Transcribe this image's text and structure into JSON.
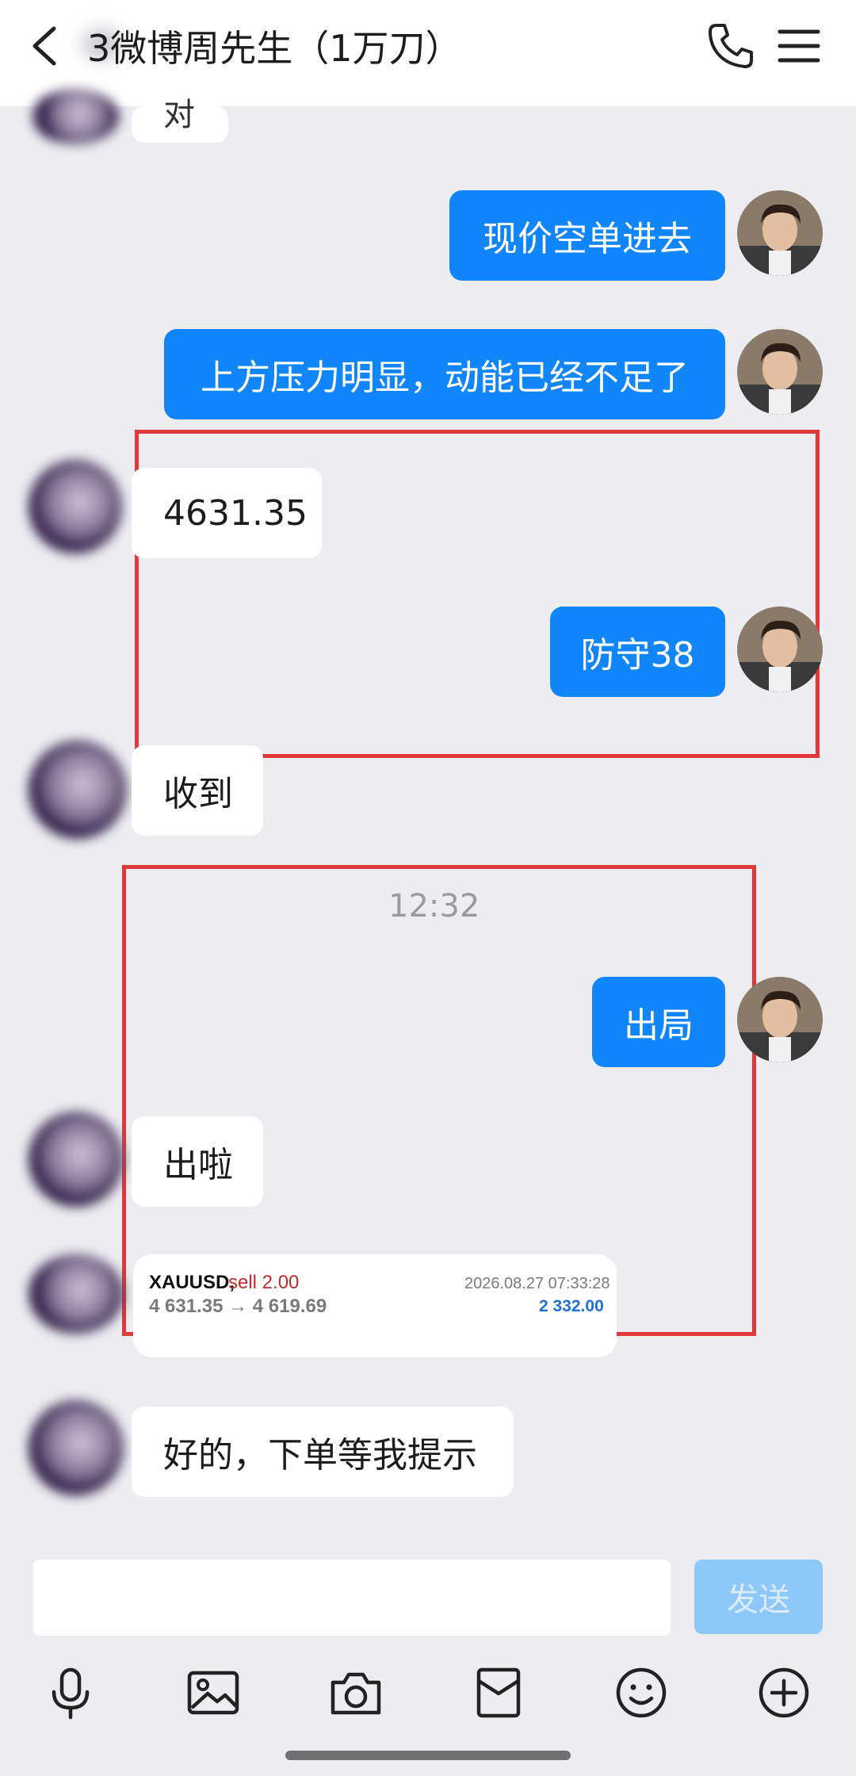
{
  "header": {
    "title": "3微博周先生（1万刀）",
    "back_icon": "chevron-left-icon",
    "phone_icon": "phone-icon",
    "menu_icon": "menu-icon"
  },
  "messages": {
    "top_partial": "对",
    "out1": "现价空单进去",
    "out2": "上方压力明显，动能已经不足了",
    "in1": "4631.35",
    "out3": "防守38",
    "in2": "收到",
    "time": "12:32",
    "out4": "出局",
    "in3": "出啦",
    "in4": "好的，下单等我提示"
  },
  "trade_card": {
    "symbol": "XAUUSD,",
    "side": "sell 2.00",
    "prices": "4 631.35 → 4 619.69",
    "datetime": "2026.08.27 07:33:28",
    "profit": "2 332.00"
  },
  "input": {
    "placeholder": "",
    "send_label": "发送"
  },
  "colors": {
    "accent": "#1185fa",
    "highlight_box": "#e0393b",
    "background": "#ececf1"
  }
}
